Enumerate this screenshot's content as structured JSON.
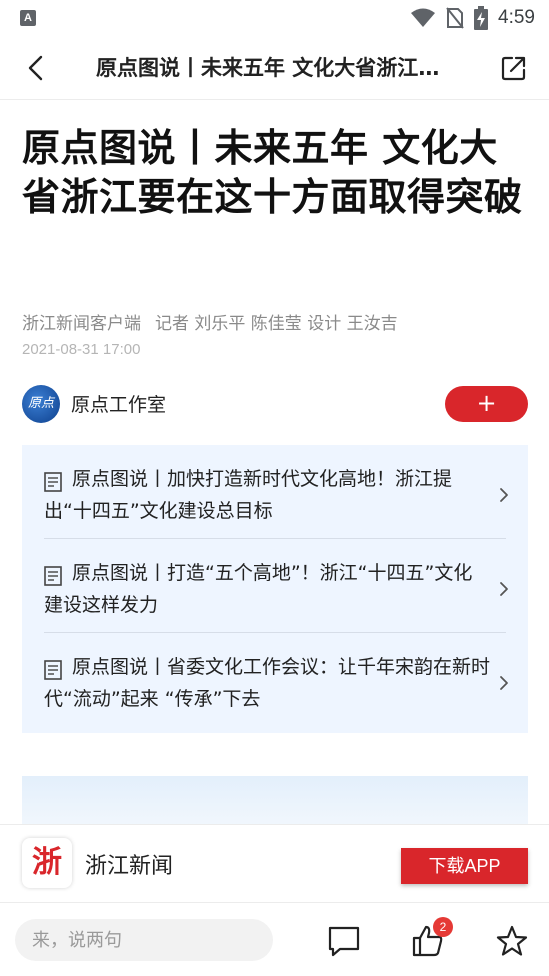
{
  "status_bar": {
    "left_icon_label": "A",
    "time": "4:59",
    "icons": [
      "notification-a-icon",
      "wifi-icon",
      "no-sim-icon",
      "battery-charging-icon"
    ]
  },
  "nav": {
    "title": "原点图说丨未来五年 文化大省浙江要在这十方面取得突破",
    "back_icon": "chevron-left-icon",
    "share_icon": "share-icon"
  },
  "article": {
    "title": "原点图说丨未来五年 文化大省浙江要在这十方面取得突破",
    "source": "浙江新闻客户端",
    "credits": "记者 刘乐平 陈佳莹 设计 王汝吉",
    "date": "2021-08-31 17:00"
  },
  "author": {
    "avatar_text": "原点",
    "name": "原点工作室",
    "follow_label": "+"
  },
  "related": [
    {
      "title": "原点图说丨加快打造新时代文化高地！浙江提出“十四五”文化建设总目标"
    },
    {
      "title": "原点图说丨打造“五个高地”！浙江“十四五”文化建设这样发力"
    },
    {
      "title": "原点图说丨省委文化工作会议：让千年宋韵在新时代“流动”起来 “传承”下去"
    }
  ],
  "promo": {
    "logo_text": "浙",
    "app_name": "浙江新闻",
    "download_label": "下载APP"
  },
  "bottom_bar": {
    "comment_placeholder": "来，说两句",
    "like_count": "2",
    "icons": [
      "comment-icon",
      "thumbs-up-icon",
      "star-icon"
    ]
  },
  "colors": {
    "brand_red": "#d9262b",
    "related_bg": "#eef5ff",
    "badge_red": "#e53935"
  }
}
